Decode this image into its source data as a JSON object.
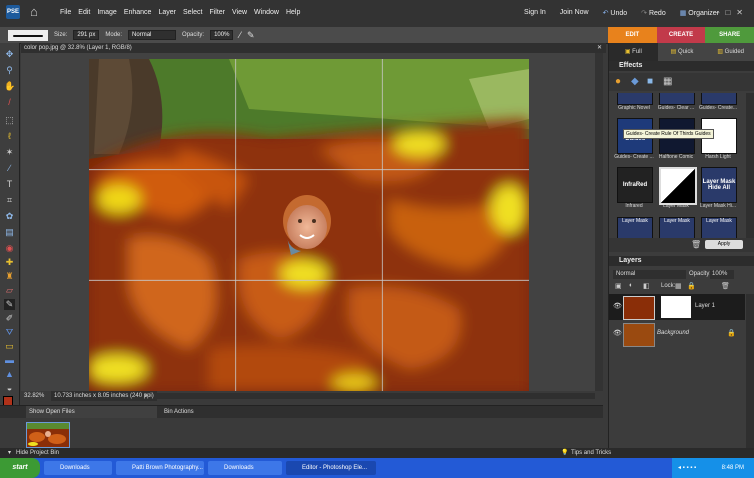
{
  "menubar": {
    "logo": "PSE",
    "items": [
      "File",
      "Edit",
      "Image",
      "Enhance",
      "Layer",
      "Select",
      "Filter",
      "View",
      "Window",
      "Help"
    ],
    "sign_in": "Sign In",
    "join_now": "Join Now",
    "undo": "Undo",
    "redo": "Redo",
    "organizer": "Organizer"
  },
  "options": {
    "size_label": "Size:",
    "size_value": "291 px",
    "mode_label": "Mode:",
    "mode_value": "Normal",
    "opacity_label": "Opacity:",
    "opacity_value": "100%"
  },
  "mode_tabs": [
    {
      "label": "EDIT",
      "color": "#e8821c"
    },
    {
      "label": "CREATE",
      "color": "#c23a4a"
    },
    {
      "label": "SHARE",
      "color": "#4f9a3c"
    }
  ],
  "document": {
    "tab_title": "color pop.jpg @ 32.8% (Layer 1, RGB/8)",
    "zoom": "32.82%",
    "doc_size": "10.733 inches x 8.05 inches (240 ppi)"
  },
  "bin": {
    "show_label": "Show Open Files",
    "actions": "Bin Actions",
    "hide": "Hide Project Bin"
  },
  "panel": {
    "tabs": [
      "Full",
      "Quick",
      "Guided"
    ],
    "effects_title": "Effects",
    "effects_row1": [
      "Graphic Novel",
      "Guides- Clear ...",
      "Guides- Create..."
    ],
    "effects_row2": [
      "Guides- Create ...",
      "Halftone Comic",
      "Harsh Light"
    ],
    "effects_row2_thumbs": [
      "Thirds Guides",
      "",
      ""
    ],
    "tooltip": "Guides- Create Rule Of Thirds Guides",
    "effects_row3": [
      "Infrared",
      "Layer Mask",
      "Layer Mask Hi..."
    ],
    "effects_row3_thumbs": [
      "InfraRed",
      "",
      "Layer Mask Hide All"
    ],
    "effects_row4_thumbs": [
      "Layer Mask",
      "Layer Mask",
      "Layer Mask"
    ],
    "apply": "Apply",
    "layers_title": "Layers",
    "blend_mode": "Normal",
    "opacity_label": "Opacity:",
    "opacity_value": "100%",
    "lock_label": "Lock:",
    "layers": [
      "Layer 1",
      "Background"
    ]
  },
  "tips": "Tips and Tricks",
  "taskbar": {
    "start": "start",
    "tasks": [
      "Downloads",
      "Patti Brown Photography...",
      "Downloads",
      "Editor - Photoshop Ele..."
    ],
    "clock": "8:48 PM"
  }
}
